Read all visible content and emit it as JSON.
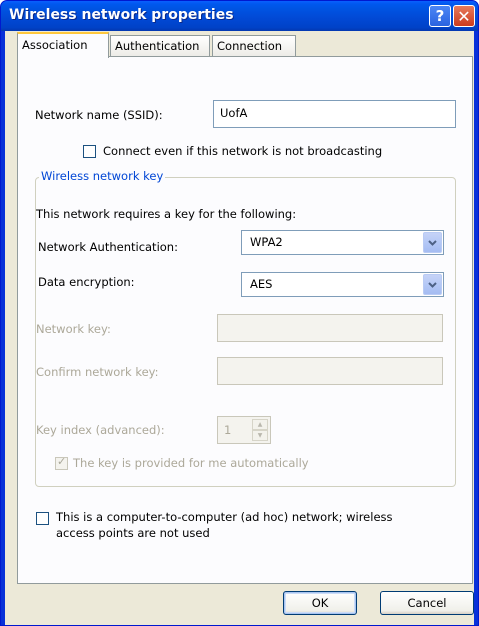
{
  "window": {
    "title": "Wireless network properties",
    "help_glyph": "?",
    "close_glyph": "✕"
  },
  "tabs": [
    {
      "label": "Association",
      "active": true
    },
    {
      "label": "Authentication",
      "active": false
    },
    {
      "label": "Connection",
      "active": false
    }
  ],
  "association": {
    "ssid_label": "Network name (SSID):",
    "ssid_value": "UofA",
    "broadcast_checkbox_label": "Connect even if this network is not broadcasting",
    "broadcast_checked": false,
    "key_group_legend": "Wireless network key",
    "key_intro": "This network requires a key for the following:",
    "auth_label": "Network Authentication:",
    "auth_value": "WPA2",
    "encryption_label": "Data encryption:",
    "encryption_value": "AES",
    "network_key_label": "Network key:",
    "network_key_value": "",
    "confirm_key_label": "Confirm network key:",
    "confirm_key_value": "",
    "key_index_label": "Key index (advanced):",
    "key_index_value": "1",
    "auto_key_label": "The key is provided for me automatically",
    "auto_key_checked": true,
    "adhoc_label_line1": "This is a computer-to-computer (ad hoc) network; wireless",
    "adhoc_label_line2": "access points are not used",
    "adhoc_checked": false
  },
  "buttons": {
    "ok_label": "OK",
    "cancel_label": "Cancel"
  },
  "colors": {
    "title_bar": "#0054e3",
    "dialog_face": "#ece9d8",
    "group_legend": "#0046d5",
    "active_tab_highlight": "#ffc83c"
  }
}
